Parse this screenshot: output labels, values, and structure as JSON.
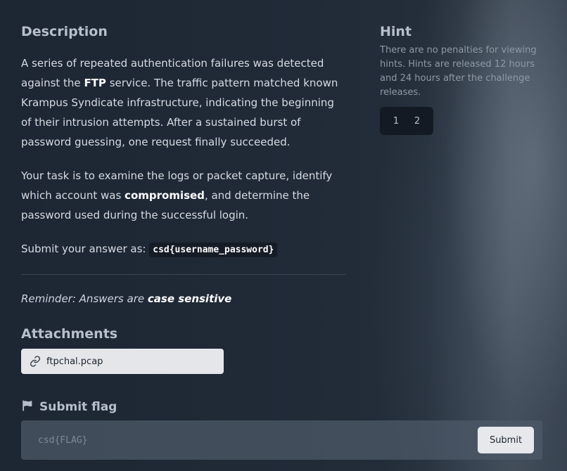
{
  "description": {
    "title": "Description",
    "p1": {
      "part1": "A series of repeated authentication failures was detected against the ",
      "bold": "FTP",
      "part2": " service. The traffic pattern matched known Krampus Syndicate infrastructure, indicating the beginning of their intrusion attempts. After a sustained burst of password guessing, one request finally succeeded."
    },
    "p2": {
      "part1": "Your task is to examine the logs or packet capture, identify which account was ",
      "bold": "compromised",
      "part2": ", and determine the password used during the successful login."
    },
    "p3": {
      "prefix": "Submit your answer as: ",
      "code": "csd{username_password}"
    },
    "reminder": {
      "prefix": "Reminder: Answers are ",
      "bold": "case sensitive"
    }
  },
  "attachments": {
    "title": "Attachments",
    "items": [
      {
        "label": "ftpchal.pcap",
        "icon": "link-icon"
      }
    ]
  },
  "submit": {
    "title": "Submit flag",
    "icon": "flag-icon",
    "placeholder": "csd{FLAG}",
    "value": "",
    "button_label": "Submit"
  },
  "hint": {
    "title": "Hint",
    "text": "There are no penalties for viewing hints. Hints are released 12 hours and 24 hours after the challenge releases.",
    "buttons": [
      "1",
      "2"
    ]
  }
}
